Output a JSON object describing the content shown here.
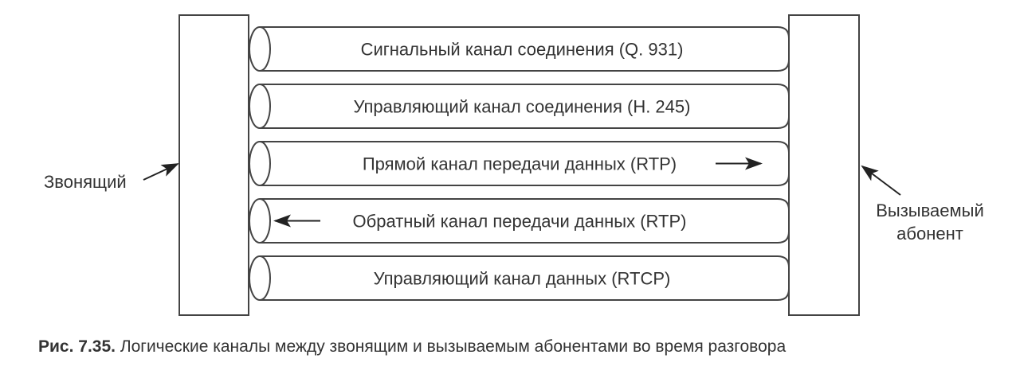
{
  "diagram": {
    "left_party": "Звонящий",
    "right_party_line1": "Вызываемый",
    "right_party_line2": "абонент",
    "channels": [
      {
        "label": "Сигнальный канал соединения (Q. 931)",
        "direction": "none"
      },
      {
        "label": "Управляющий канал соединения (H. 245)",
        "direction": "none"
      },
      {
        "label": "Прямой канал передачи данных (RTP)",
        "direction": "right"
      },
      {
        "label": "Обратный канал передачи данных (RTP)",
        "direction": "left"
      },
      {
        "label": "Управляющий канал данных (RTCP)",
        "direction": "none"
      }
    ]
  },
  "caption": {
    "number": "Рис. 7.35.",
    "text": "Логические каналы между звонящим и вызываемым абонентами во время разговора"
  }
}
